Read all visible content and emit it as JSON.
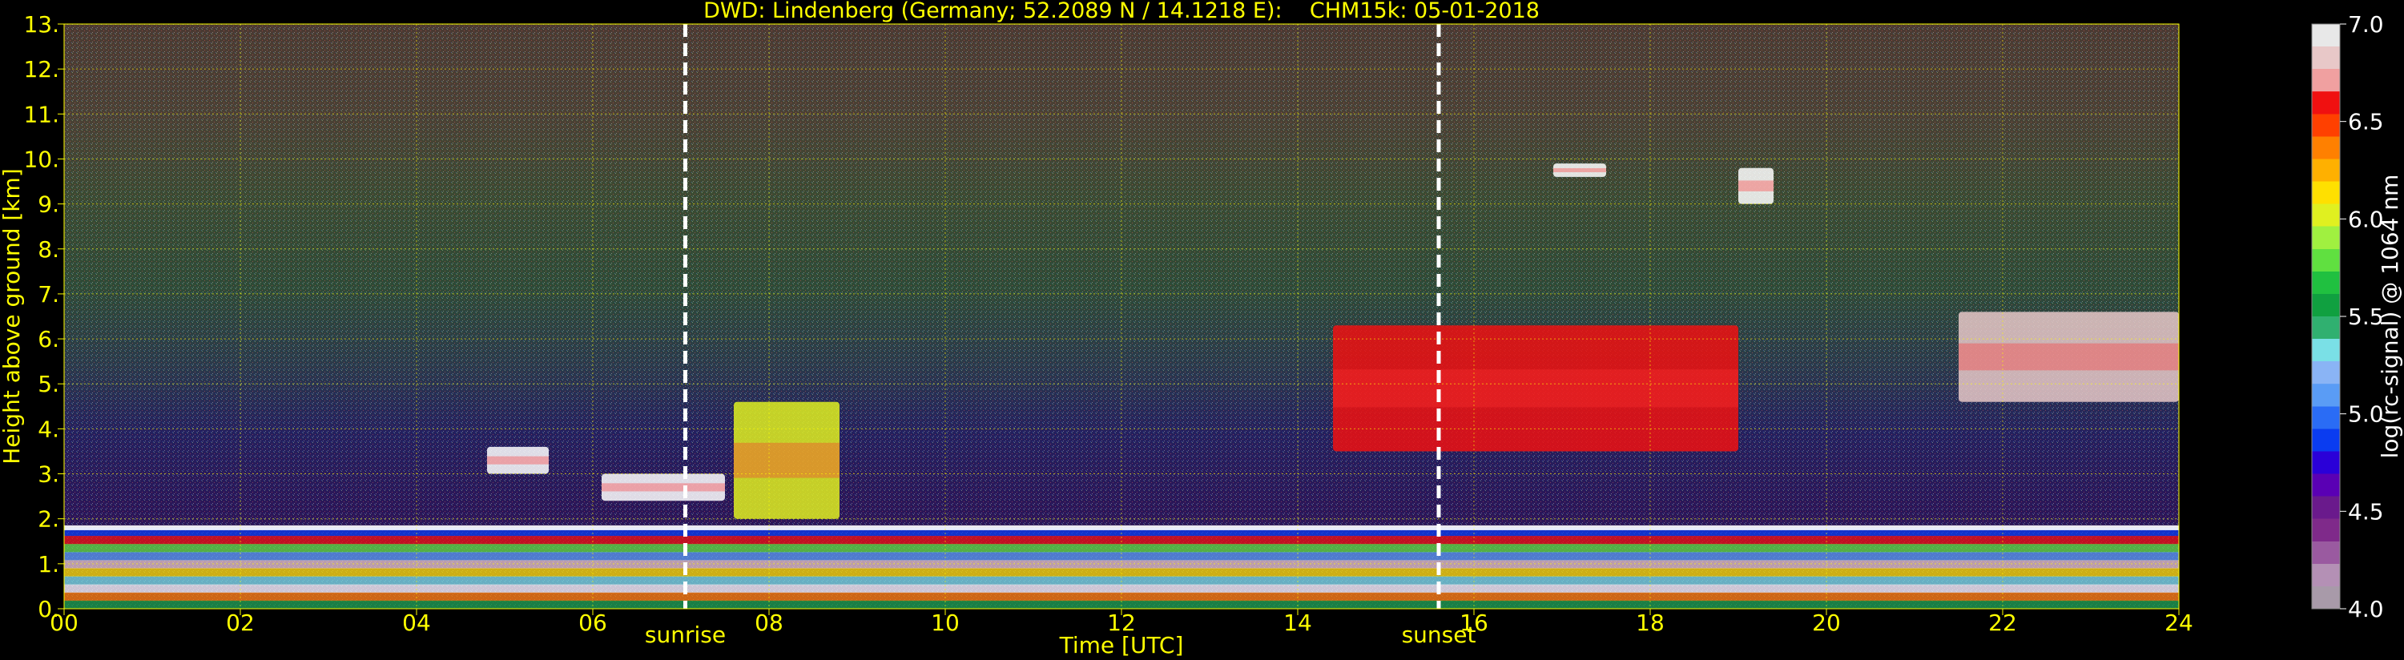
{
  "chart_data": {
    "type": "heatmap",
    "title": "DWD: Lindenberg (Germany; 52.2089 N / 14.1218 E):    CHM15k: 05-01-2018",
    "xlabel": "Time [UTC]",
    "ylabel": "Height above ground [km]",
    "xlim": [
      0,
      24
    ],
    "ylim": [
      0,
      13
    ],
    "x_ticks": [
      0,
      2,
      4,
      6,
      8,
      10,
      12,
      14,
      16,
      18,
      20,
      22,
      24
    ],
    "x_tick_labels": [
      "00",
      "02",
      "04",
      "06",
      "08",
      "10",
      "12",
      "14",
      "16",
      "18",
      "20",
      "22",
      "24"
    ],
    "y_ticks": [
      0,
      1,
      2,
      3,
      4,
      5,
      6,
      7,
      8,
      9,
      10,
      11,
      12,
      13
    ],
    "y_tick_labels": [
      "0.",
      "1.",
      "2.",
      "3.",
      "4.",
      "5.",
      "6.",
      "7.",
      "8.",
      "9.",
      "10.",
      "11.",
      "12.",
      "13."
    ],
    "grid": true,
    "colorbar": {
      "label": "log(rc-signal) @ 1064 nm",
      "range": [
        4.0,
        7.0
      ],
      "ticks": [
        4.0,
        4.5,
        5.0,
        5.5,
        6.0,
        6.5,
        7.0
      ],
      "tick_labels": [
        "4.0",
        "4.5",
        "5.0",
        "5.5",
        "6.0",
        "6.5",
        "7.0"
      ],
      "colors": [
        "#a89aa9",
        "#b490b5",
        "#9a5aa0",
        "#7f2a8a",
        "#6a1a8c",
        "#5a00b4",
        "#2a00d8",
        "#0a3cf0",
        "#2a6cf5",
        "#5a9cf5",
        "#8ab4f5",
        "#7ae0e6",
        "#30b070",
        "#10a040",
        "#20c040",
        "#60e040",
        "#a0f040",
        "#e0f020",
        "#ffe000",
        "#ffb000",
        "#ff8000",
        "#ff4000",
        "#f01010",
        "#f0a0a0",
        "#e8c8c8",
        "#e8e8e8",
        "#ffffff"
      ]
    },
    "events": [
      {
        "label": "sunrise",
        "time": 7.05
      },
      {
        "label": "sunset",
        "time": 15.6
      }
    ],
    "features": [
      {
        "kind": "boundary-layer",
        "t_start": 0,
        "t_end": 24,
        "top_km": 1.8,
        "value_range": [
          4.8,
          7.0
        ]
      },
      {
        "kind": "cloud",
        "t_start": 4.8,
        "t_end": 5.5,
        "base_km": 3.0,
        "top_km": 3.6,
        "value": 7.0
      },
      {
        "kind": "cloud",
        "t_start": 6.1,
        "t_end": 7.5,
        "base_km": 2.4,
        "top_km": 3.0,
        "value": 7.0
      },
      {
        "kind": "cloud",
        "t_start": 7.6,
        "t_end": 8.8,
        "base_km": 2.0,
        "top_km": 4.6,
        "value": 6.0
      },
      {
        "kind": "cloud",
        "t_start": 14.4,
        "t_end": 19.0,
        "base_km": 3.5,
        "top_km": 6.3,
        "value": 6.5
      },
      {
        "kind": "cloud",
        "t_start": 16.9,
        "t_end": 17.5,
        "base_km": 9.6,
        "top_km": 9.9,
        "value": 7.0
      },
      {
        "kind": "cloud",
        "t_start": 19.0,
        "t_end": 19.4,
        "base_km": 9.0,
        "top_km": 9.8,
        "value": 7.0
      },
      {
        "kind": "cloud",
        "t_start": 21.5,
        "t_end": 24.0,
        "base_km": 4.6,
        "top_km": 6.6,
        "value": 6.8
      }
    ]
  }
}
